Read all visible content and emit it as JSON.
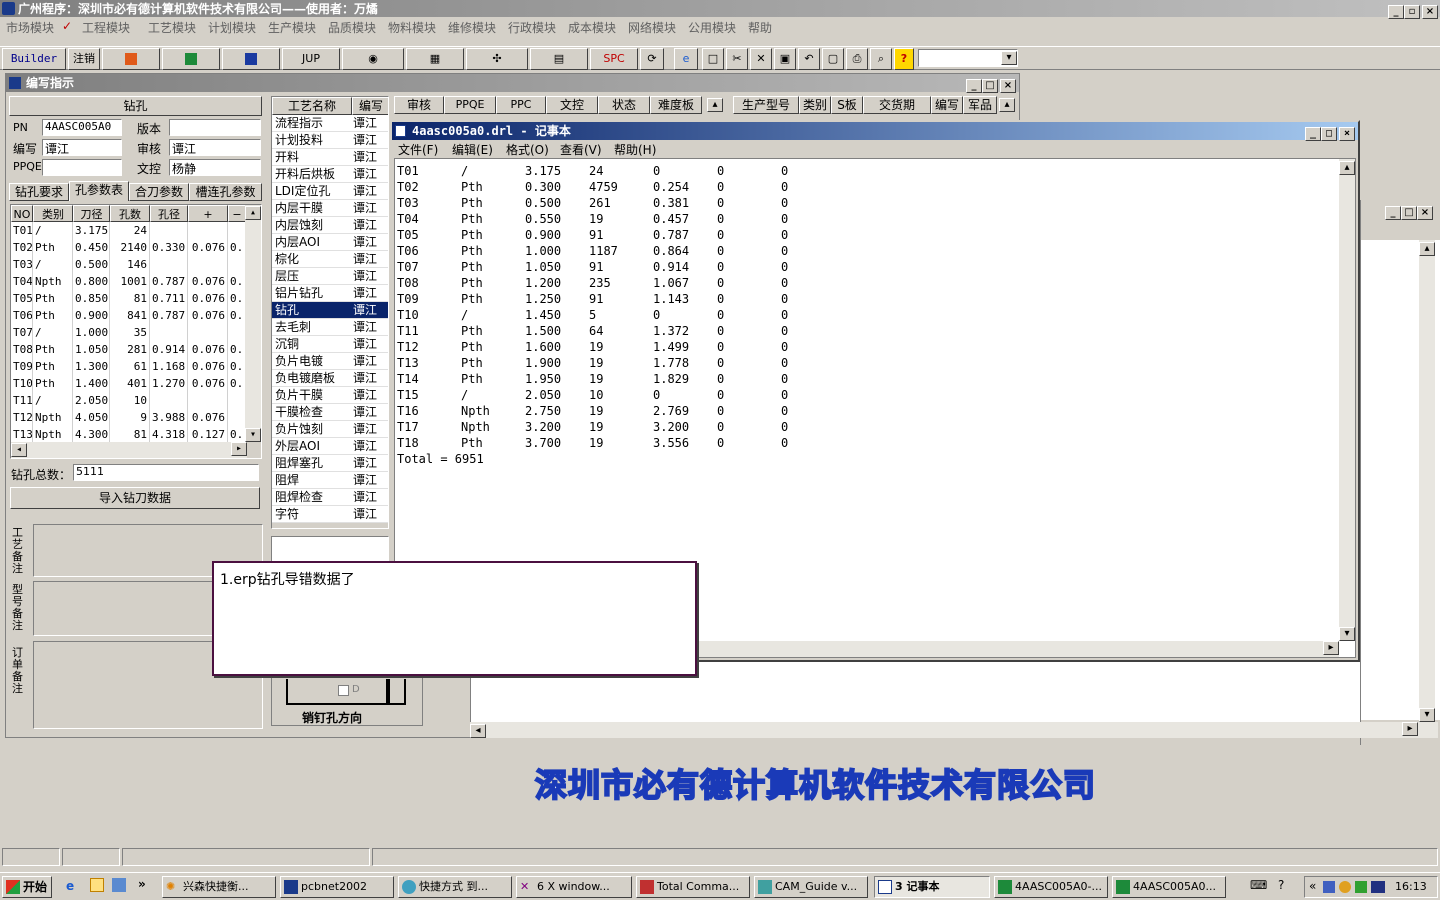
{
  "app_title": "广州程序：深圳市必有德计算机软件技术有限公司——使用者：万燏",
  "menu": [
    "市场模块",
    "工程模块",
    "工艺模块",
    "计划模块",
    "生产模块",
    "品质模块",
    "物料模块",
    "维修模块",
    "行政模块",
    "成本模块",
    "网络模块",
    "公用模块",
    "帮助"
  ],
  "toolbar": {
    "builder": "Builder",
    "logout": "注销",
    "jup": "JUP",
    "spc": "SPC",
    "help": "?"
  },
  "edit_window": {
    "title": "编写指示",
    "section": "钻孔",
    "fields": {
      "pn_label": "PN",
      "pn": "4AASC005A0",
      "version_label": "版本",
      "version": "",
      "editor_label": "编写",
      "editor": "谭江",
      "reviewer_label": "审核",
      "reviewer": "谭江",
      "ppqe_label": "PPQE",
      "ppqe": "",
      "doc_label": "文控",
      "doc": "杨静"
    },
    "tabs": [
      "钻孔要求",
      "孔参数表",
      "合刀参数",
      "槽连孔参数"
    ],
    "grid_headers": [
      "NO",
      "类别",
      "刀径",
      "孔数",
      "孔径",
      "+",
      "−"
    ],
    "grid_rows": [
      [
        "T01",
        "/",
        "3.175",
        "24",
        "",
        "",
        ""
      ],
      [
        "T02",
        "Pth",
        "0.450",
        "2140",
        "0.330",
        "0.076",
        "0."
      ],
      [
        "T03",
        "/",
        "0.500",
        "146",
        "",
        "",
        ""
      ],
      [
        "T04",
        "Npth",
        "0.800",
        "1001",
        "0.787",
        "0.076",
        "0."
      ],
      [
        "T05",
        "Pth",
        "0.850",
        "81",
        "0.711",
        "0.076",
        "0."
      ],
      [
        "T06",
        "Pth",
        "0.900",
        "841",
        "0.787",
        "0.076",
        "0."
      ],
      [
        "T07",
        "/",
        "1.000",
        "35",
        "",
        "",
        ""
      ],
      [
        "T08",
        "Pth",
        "1.050",
        "281",
        "0.914",
        "0.076",
        "0."
      ],
      [
        "T09",
        "Pth",
        "1.300",
        "61",
        "1.168",
        "0.076",
        "0."
      ],
      [
        "T10",
        "Pth",
        "1.400",
        "401",
        "1.270",
        "0.076",
        "0."
      ],
      [
        "T11",
        "/",
        "2.050",
        "10",
        "",
        "",
        ""
      ],
      [
        "T12",
        "Npth",
        "4.050",
        "9",
        "3.988",
        "0.076",
        ""
      ],
      [
        "T13",
        "Npth",
        "4.300",
        "81",
        "4.318",
        "0.127",
        "0."
      ]
    ],
    "total_label": "钻孔总数：",
    "total": "5111",
    "import_button": "导入钻刀数据",
    "notes": [
      "工艺备注",
      "型号备注",
      "订单备注"
    ],
    "pin_label": "销钉孔方向",
    "pin_d": "D",
    "process_headers": [
      "工艺名称",
      "编写",
      "审核",
      "PPQE",
      "PPC",
      "文控",
      "状态",
      "难度板"
    ],
    "processes": [
      [
        "流程指示",
        "谭江"
      ],
      [
        "计划投料",
        "谭江"
      ],
      [
        "开料",
        "谭江"
      ],
      [
        "开料后烘板",
        "谭江"
      ],
      [
        "LDI定位孔",
        "谭江"
      ],
      [
        "内层干膜",
        "谭江"
      ],
      [
        "内层蚀刻",
        "谭江"
      ],
      [
        "内层AOI",
        "谭江"
      ],
      [
        "棕化",
        "谭江"
      ],
      [
        "层压",
        "谭江"
      ],
      [
        "铝片钻孔",
        "谭江"
      ],
      [
        "钻孔",
        "谭江"
      ],
      [
        "去毛刺",
        "谭江"
      ],
      [
        "沉铜",
        "谭江"
      ],
      [
        "负片电镀",
        "谭江"
      ],
      [
        "负电镀磨板",
        "谭江"
      ],
      [
        "负片干膜",
        "谭江"
      ],
      [
        "干膜检查",
        "谭江"
      ],
      [
        "负片蚀刻",
        "谭江"
      ],
      [
        "外层AOI",
        "谭江"
      ],
      [
        "阻焊塞孔",
        "谭江"
      ],
      [
        "阻焊",
        "谭江"
      ],
      [
        "阻焊检查",
        "谭江"
      ],
      [
        "字符",
        "谭江"
      ]
    ],
    "right_headers": [
      "生产型号",
      "类别",
      "S板",
      "交货期",
      "编写",
      "军品"
    ]
  },
  "notepad": {
    "title": "4aasc005a0.drl - 记事本",
    "menu": [
      "文件(F)",
      "编辑(E)",
      "格式(O)",
      "查看(V)",
      "帮助(H)"
    ],
    "lines": [
      [
        "T01",
        "/",
        "3.175",
        "24",
        "0",
        "0",
        "0"
      ],
      [
        "T02",
        "Pth",
        "0.300",
        "4759",
        "0.254",
        "0",
        "0"
      ],
      [
        "T03",
        "Pth",
        "0.500",
        "261",
        "0.381",
        "0",
        "0"
      ],
      [
        "T04",
        "Pth",
        "0.550",
        "19",
        "0.457",
        "0",
        "0"
      ],
      [
        "T05",
        "Pth",
        "0.900",
        "91",
        "0.787",
        "0",
        "0"
      ],
      [
        "T06",
        "Pth",
        "1.000",
        "1187",
        "0.864",
        "0",
        "0"
      ],
      [
        "T07",
        "Pth",
        "1.050",
        "91",
        "0.914",
        "0",
        "0"
      ],
      [
        "T08",
        "Pth",
        "1.200",
        "235",
        "1.067",
        "0",
        "0"
      ],
      [
        "T09",
        "Pth",
        "1.250",
        "91",
        "1.143",
        "0",
        "0"
      ],
      [
        "T10",
        "/",
        "1.450",
        "5",
        "0",
        "0",
        "0"
      ],
      [
        "T11",
        "Pth",
        "1.500",
        "64",
        "1.372",
        "0",
        "0"
      ],
      [
        "T12",
        "Pth",
        "1.600",
        "19",
        "1.499",
        "0",
        "0"
      ],
      [
        "T13",
        "Pth",
        "1.900",
        "19",
        "1.778",
        "0",
        "0"
      ],
      [
        "T14",
        "Pth",
        "1.950",
        "19",
        "1.829",
        "0",
        "0"
      ],
      [
        "T15",
        "/",
        "2.050",
        "10",
        "0",
        "0",
        "0"
      ],
      [
        "T16",
        "Npth",
        "2.750",
        "19",
        "2.769",
        "0",
        "0"
      ],
      [
        "T17",
        "Npth",
        "3.200",
        "19",
        "3.200",
        "0",
        "0"
      ],
      [
        "T18",
        "Pth",
        "3.700",
        "19",
        "3.556",
        "0",
        "0"
      ]
    ],
    "total_line": "Total = 6951"
  },
  "callout": "1.erp钻孔导错数据了",
  "banner": "深圳市必有德计算机软件技术有限公司",
  "taskbar": {
    "start": "开始",
    "tasks": [
      "兴森快捷衡...",
      "pcbnet2002",
      "快捷方式 到...",
      "6 X window...",
      "Total Comma...",
      "CAM_Guide v...",
      "3 记事本",
      "4AASC005A0-...",
      "4AASC005A0..."
    ],
    "clock": "16:13"
  }
}
